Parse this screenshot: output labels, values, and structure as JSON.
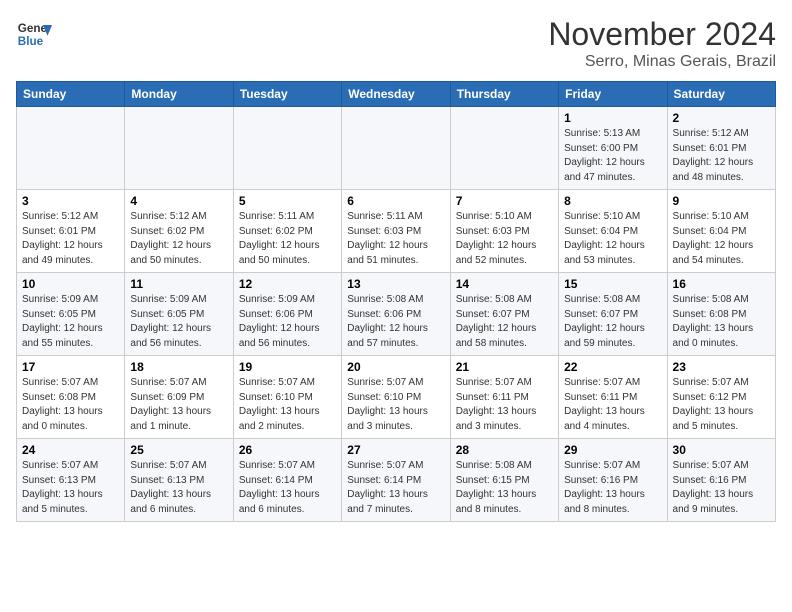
{
  "logo": {
    "line1": "General",
    "line2": "Blue"
  },
  "title": "November 2024",
  "location": "Serro, Minas Gerais, Brazil",
  "weekdays": [
    "Sunday",
    "Monday",
    "Tuesday",
    "Wednesday",
    "Thursday",
    "Friday",
    "Saturday"
  ],
  "weeks": [
    [
      {
        "day": "",
        "info": ""
      },
      {
        "day": "",
        "info": ""
      },
      {
        "day": "",
        "info": ""
      },
      {
        "day": "",
        "info": ""
      },
      {
        "day": "",
        "info": ""
      },
      {
        "day": "1",
        "info": "Sunrise: 5:13 AM\nSunset: 6:00 PM\nDaylight: 12 hours\nand 47 minutes."
      },
      {
        "day": "2",
        "info": "Sunrise: 5:12 AM\nSunset: 6:01 PM\nDaylight: 12 hours\nand 48 minutes."
      }
    ],
    [
      {
        "day": "3",
        "info": "Sunrise: 5:12 AM\nSunset: 6:01 PM\nDaylight: 12 hours\nand 49 minutes."
      },
      {
        "day": "4",
        "info": "Sunrise: 5:12 AM\nSunset: 6:02 PM\nDaylight: 12 hours\nand 50 minutes."
      },
      {
        "day": "5",
        "info": "Sunrise: 5:11 AM\nSunset: 6:02 PM\nDaylight: 12 hours\nand 50 minutes."
      },
      {
        "day": "6",
        "info": "Sunrise: 5:11 AM\nSunset: 6:03 PM\nDaylight: 12 hours\nand 51 minutes."
      },
      {
        "day": "7",
        "info": "Sunrise: 5:10 AM\nSunset: 6:03 PM\nDaylight: 12 hours\nand 52 minutes."
      },
      {
        "day": "8",
        "info": "Sunrise: 5:10 AM\nSunset: 6:04 PM\nDaylight: 12 hours\nand 53 minutes."
      },
      {
        "day": "9",
        "info": "Sunrise: 5:10 AM\nSunset: 6:04 PM\nDaylight: 12 hours\nand 54 minutes."
      }
    ],
    [
      {
        "day": "10",
        "info": "Sunrise: 5:09 AM\nSunset: 6:05 PM\nDaylight: 12 hours\nand 55 minutes."
      },
      {
        "day": "11",
        "info": "Sunrise: 5:09 AM\nSunset: 6:05 PM\nDaylight: 12 hours\nand 56 minutes."
      },
      {
        "day": "12",
        "info": "Sunrise: 5:09 AM\nSunset: 6:06 PM\nDaylight: 12 hours\nand 56 minutes."
      },
      {
        "day": "13",
        "info": "Sunrise: 5:08 AM\nSunset: 6:06 PM\nDaylight: 12 hours\nand 57 minutes."
      },
      {
        "day": "14",
        "info": "Sunrise: 5:08 AM\nSunset: 6:07 PM\nDaylight: 12 hours\nand 58 minutes."
      },
      {
        "day": "15",
        "info": "Sunrise: 5:08 AM\nSunset: 6:07 PM\nDaylight: 12 hours\nand 59 minutes."
      },
      {
        "day": "16",
        "info": "Sunrise: 5:08 AM\nSunset: 6:08 PM\nDaylight: 13 hours\nand 0 minutes."
      }
    ],
    [
      {
        "day": "17",
        "info": "Sunrise: 5:07 AM\nSunset: 6:08 PM\nDaylight: 13 hours\nand 0 minutes."
      },
      {
        "day": "18",
        "info": "Sunrise: 5:07 AM\nSunset: 6:09 PM\nDaylight: 13 hours\nand 1 minute."
      },
      {
        "day": "19",
        "info": "Sunrise: 5:07 AM\nSunset: 6:10 PM\nDaylight: 13 hours\nand 2 minutes."
      },
      {
        "day": "20",
        "info": "Sunrise: 5:07 AM\nSunset: 6:10 PM\nDaylight: 13 hours\nand 3 minutes."
      },
      {
        "day": "21",
        "info": "Sunrise: 5:07 AM\nSunset: 6:11 PM\nDaylight: 13 hours\nand 3 minutes."
      },
      {
        "day": "22",
        "info": "Sunrise: 5:07 AM\nSunset: 6:11 PM\nDaylight: 13 hours\nand 4 minutes."
      },
      {
        "day": "23",
        "info": "Sunrise: 5:07 AM\nSunset: 6:12 PM\nDaylight: 13 hours\nand 5 minutes."
      }
    ],
    [
      {
        "day": "24",
        "info": "Sunrise: 5:07 AM\nSunset: 6:13 PM\nDaylight: 13 hours\nand 5 minutes."
      },
      {
        "day": "25",
        "info": "Sunrise: 5:07 AM\nSunset: 6:13 PM\nDaylight: 13 hours\nand 6 minutes."
      },
      {
        "day": "26",
        "info": "Sunrise: 5:07 AM\nSunset: 6:14 PM\nDaylight: 13 hours\nand 6 minutes."
      },
      {
        "day": "27",
        "info": "Sunrise: 5:07 AM\nSunset: 6:14 PM\nDaylight: 13 hours\nand 7 minutes."
      },
      {
        "day": "28",
        "info": "Sunrise: 5:08 AM\nSunset: 6:15 PM\nDaylight: 13 hours\nand 8 minutes."
      },
      {
        "day": "29",
        "info": "Sunrise: 5:07 AM\nSunset: 6:16 PM\nDaylight: 13 hours\nand 8 minutes."
      },
      {
        "day": "30",
        "info": "Sunrise: 5:07 AM\nSunset: 6:16 PM\nDaylight: 13 hours\nand 9 minutes."
      }
    ]
  ]
}
